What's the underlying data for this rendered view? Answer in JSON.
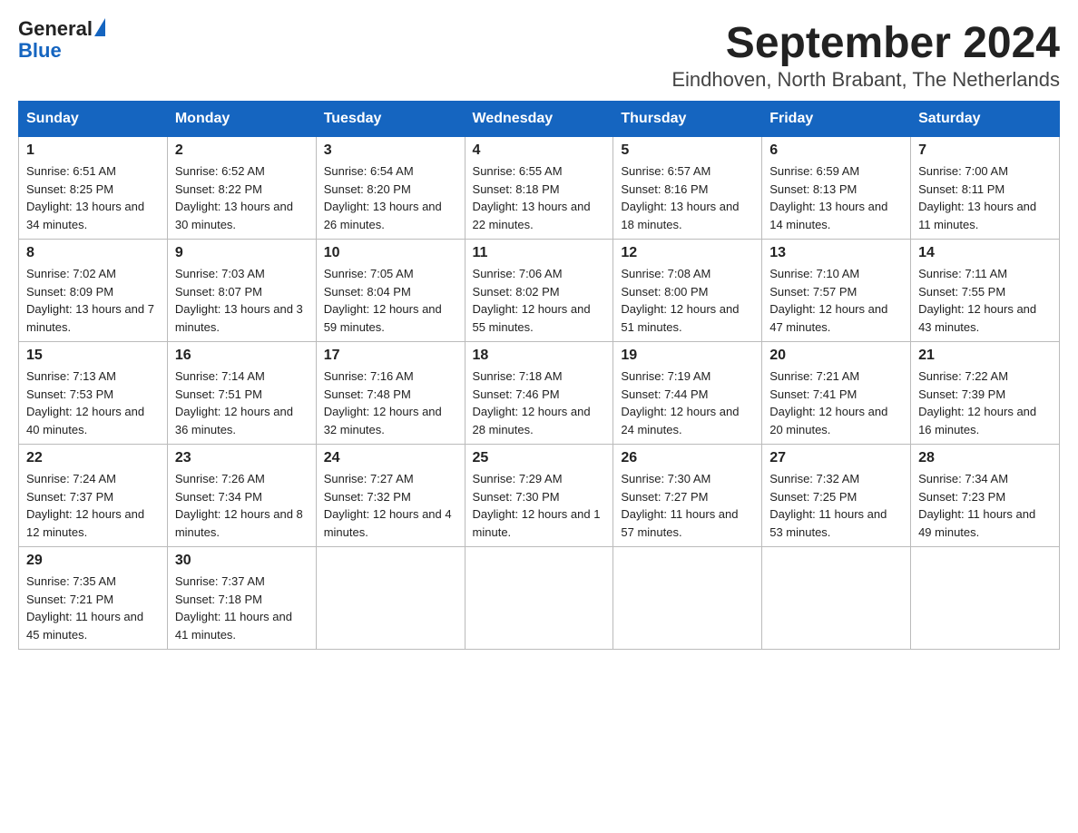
{
  "header": {
    "logo_general": "General",
    "logo_blue": "Blue",
    "month_title": "September 2024",
    "location": "Eindhoven, North Brabant, The Netherlands"
  },
  "days_of_week": [
    "Sunday",
    "Monday",
    "Tuesday",
    "Wednesday",
    "Thursday",
    "Friday",
    "Saturday"
  ],
  "weeks": [
    [
      {
        "day": "1",
        "sunrise": "6:51 AM",
        "sunset": "8:25 PM",
        "daylight": "13 hours and 34 minutes."
      },
      {
        "day": "2",
        "sunrise": "6:52 AM",
        "sunset": "8:22 PM",
        "daylight": "13 hours and 30 minutes."
      },
      {
        "day": "3",
        "sunrise": "6:54 AM",
        "sunset": "8:20 PM",
        "daylight": "13 hours and 26 minutes."
      },
      {
        "day": "4",
        "sunrise": "6:55 AM",
        "sunset": "8:18 PM",
        "daylight": "13 hours and 22 minutes."
      },
      {
        "day": "5",
        "sunrise": "6:57 AM",
        "sunset": "8:16 PM",
        "daylight": "13 hours and 18 minutes."
      },
      {
        "day": "6",
        "sunrise": "6:59 AM",
        "sunset": "8:13 PM",
        "daylight": "13 hours and 14 minutes."
      },
      {
        "day": "7",
        "sunrise": "7:00 AM",
        "sunset": "8:11 PM",
        "daylight": "13 hours and 11 minutes."
      }
    ],
    [
      {
        "day": "8",
        "sunrise": "7:02 AM",
        "sunset": "8:09 PM",
        "daylight": "13 hours and 7 minutes."
      },
      {
        "day": "9",
        "sunrise": "7:03 AM",
        "sunset": "8:07 PM",
        "daylight": "13 hours and 3 minutes."
      },
      {
        "day": "10",
        "sunrise": "7:05 AM",
        "sunset": "8:04 PM",
        "daylight": "12 hours and 59 minutes."
      },
      {
        "day": "11",
        "sunrise": "7:06 AM",
        "sunset": "8:02 PM",
        "daylight": "12 hours and 55 minutes."
      },
      {
        "day": "12",
        "sunrise": "7:08 AM",
        "sunset": "8:00 PM",
        "daylight": "12 hours and 51 minutes."
      },
      {
        "day": "13",
        "sunrise": "7:10 AM",
        "sunset": "7:57 PM",
        "daylight": "12 hours and 47 minutes."
      },
      {
        "day": "14",
        "sunrise": "7:11 AM",
        "sunset": "7:55 PM",
        "daylight": "12 hours and 43 minutes."
      }
    ],
    [
      {
        "day": "15",
        "sunrise": "7:13 AM",
        "sunset": "7:53 PM",
        "daylight": "12 hours and 40 minutes."
      },
      {
        "day": "16",
        "sunrise": "7:14 AM",
        "sunset": "7:51 PM",
        "daylight": "12 hours and 36 minutes."
      },
      {
        "day": "17",
        "sunrise": "7:16 AM",
        "sunset": "7:48 PM",
        "daylight": "12 hours and 32 minutes."
      },
      {
        "day": "18",
        "sunrise": "7:18 AM",
        "sunset": "7:46 PM",
        "daylight": "12 hours and 28 minutes."
      },
      {
        "day": "19",
        "sunrise": "7:19 AM",
        "sunset": "7:44 PM",
        "daylight": "12 hours and 24 minutes."
      },
      {
        "day": "20",
        "sunrise": "7:21 AM",
        "sunset": "7:41 PM",
        "daylight": "12 hours and 20 minutes."
      },
      {
        "day": "21",
        "sunrise": "7:22 AM",
        "sunset": "7:39 PM",
        "daylight": "12 hours and 16 minutes."
      }
    ],
    [
      {
        "day": "22",
        "sunrise": "7:24 AM",
        "sunset": "7:37 PM",
        "daylight": "12 hours and 12 minutes."
      },
      {
        "day": "23",
        "sunrise": "7:26 AM",
        "sunset": "7:34 PM",
        "daylight": "12 hours and 8 minutes."
      },
      {
        "day": "24",
        "sunrise": "7:27 AM",
        "sunset": "7:32 PM",
        "daylight": "12 hours and 4 minutes."
      },
      {
        "day": "25",
        "sunrise": "7:29 AM",
        "sunset": "7:30 PM",
        "daylight": "12 hours and 1 minute."
      },
      {
        "day": "26",
        "sunrise": "7:30 AM",
        "sunset": "7:27 PM",
        "daylight": "11 hours and 57 minutes."
      },
      {
        "day": "27",
        "sunrise": "7:32 AM",
        "sunset": "7:25 PM",
        "daylight": "11 hours and 53 minutes."
      },
      {
        "day": "28",
        "sunrise": "7:34 AM",
        "sunset": "7:23 PM",
        "daylight": "11 hours and 49 minutes."
      }
    ],
    [
      {
        "day": "29",
        "sunrise": "7:35 AM",
        "sunset": "7:21 PM",
        "daylight": "11 hours and 45 minutes."
      },
      {
        "day": "30",
        "sunrise": "7:37 AM",
        "sunset": "7:18 PM",
        "daylight": "11 hours and 41 minutes."
      },
      null,
      null,
      null,
      null,
      null
    ]
  ]
}
